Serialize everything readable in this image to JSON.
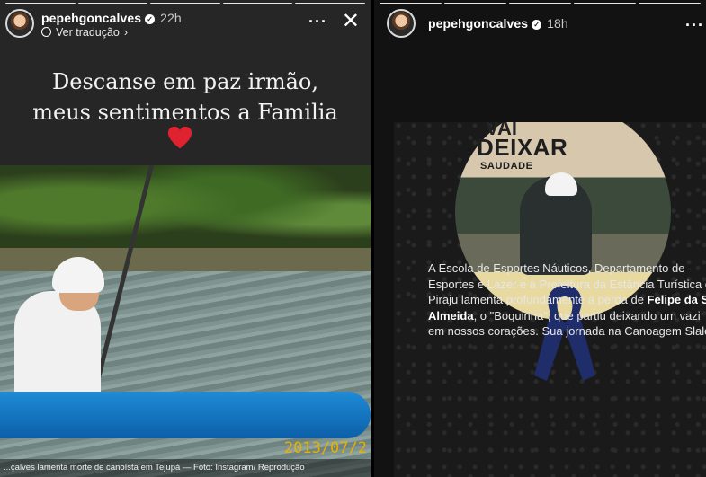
{
  "left_story": {
    "username": "pepehgoncalves",
    "time": "22h",
    "translate_label": "Ver tradução",
    "caption_line1": "Descanse em paz irmão,",
    "caption_line2": "meus sentimentos a Familia",
    "photo_date": "2013/07/2",
    "footer": "...çalves lamenta morte de canoísta em Tejupá — Foto: Instagram/ Reprodução",
    "progress_total": 5,
    "progress_done": 5
  },
  "right_story": {
    "username": "pepehgoncalves",
    "time": "18h",
    "post": {
      "vai": "VAI",
      "deixar": "DEIXAR",
      "saudade": "SAUDADE",
      "line1": "A Escola de Esportes Náuticos, Departamento de",
      "line2": "Esportes e Lazer e a Prefeitura da Estância Turística d",
      "line3_prefix": "Piraju lamenta profundamente a perda de ",
      "line3_name": "Felipe da Sil",
      "line4_name": "Almeida",
      "line4_rest": ", o \"Boquinha\", que partiu deixando um vazi",
      "line5": "em nossos corações. Sua jornada na Canoagem Slalo"
    },
    "progress_total": 5,
    "progress_done": 5
  },
  "icons": {
    "verified": "verified-badge-icon",
    "translate": "translate-icon",
    "more": "more-options-icon",
    "close": "close-icon",
    "heart": "red-heart-icon",
    "ribbon": "mourning-ribbon-icon"
  },
  "colors": {
    "heart": "#e0212f",
    "ribbon": "#1f2d6b",
    "photo_date": "#e8b000"
  }
}
